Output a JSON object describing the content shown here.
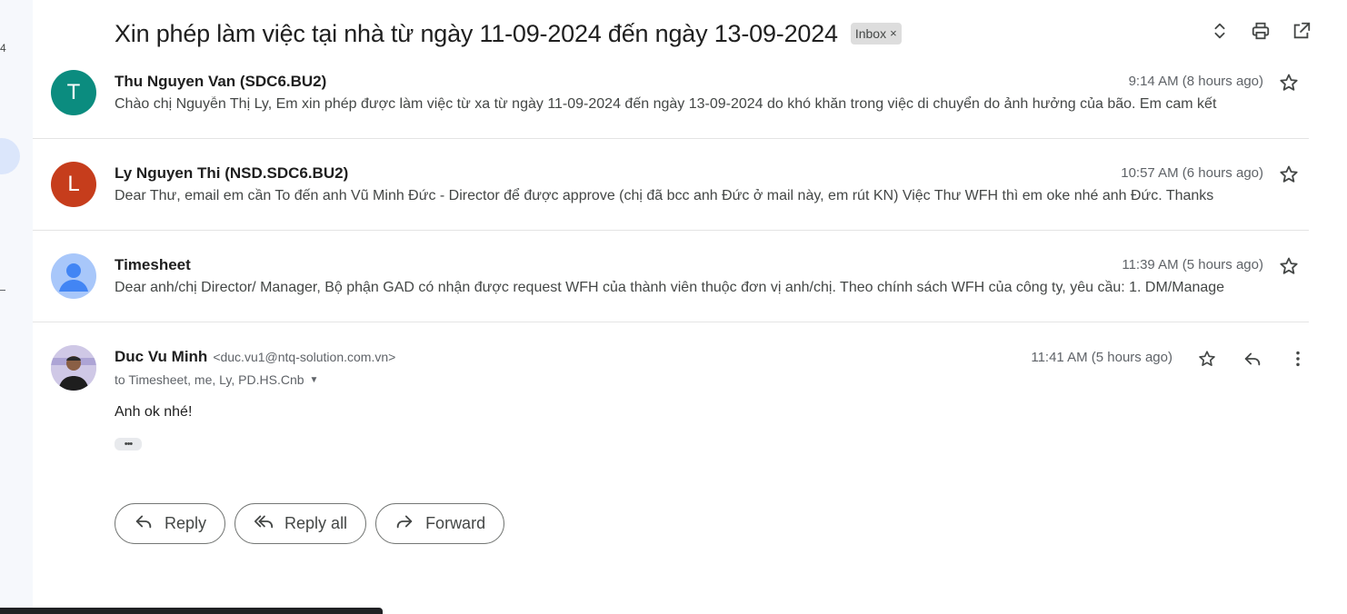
{
  "sidebar": {
    "count": "4"
  },
  "subject": {
    "title": "Xin phép làm việc tại nhà từ ngày 11-09-2024 đến ngày 13-09-2024",
    "label": "Inbox",
    "label_remove": "×"
  },
  "messages": [
    {
      "avatar_letter": "T",
      "avatar_color": "#0b8c7f",
      "sender": "Thu Nguyen Van (SDC6.BU2)",
      "time": "9:14 AM (8 hours ago)",
      "snippet": "Chào chị Nguyễn Thị Ly, Em xin phép được làm việc từ xa từ ngày 11-09-2024 đến ngày 13-09-2024 do khó khăn trong việc di chuyển do ảnh hưởng của bão. Em cam kết"
    },
    {
      "avatar_letter": "L",
      "avatar_color": "#c63d1c",
      "sender": "Ly Nguyen Thi (NSD.SDC6.BU2)",
      "time": "10:57 AM (6 hours ago)",
      "snippet": "Dear Thư, email em cần To đến anh Vũ Minh Đức - Director để được approve (chị đã bcc anh Đức ở mail này, em rút KN) Việc Thư WFH thì em oke nhé anh Đức. Thanks"
    },
    {
      "avatar_letter": "",
      "avatar_color": "#a8c7fa",
      "sender": "Timesheet",
      "time": "11:39 AM (5 hours ago)",
      "snippet": "Dear anh/chị Director/ Manager, Bộ phận GAD có nhận được request WFH của thành viên thuộc đơn vị anh/chị. Theo chính sách WFH của công ty, yêu cầu: 1. DM/Manage"
    }
  ],
  "open_message": {
    "sender_name": "Duc Vu Minh",
    "sender_email": "<duc.vu1@ntq-solution.com.vn>",
    "recipients": "to Timesheet, me, Ly, PD.HS.Cnb",
    "time": "11:41 AM (5 hours ago)",
    "body": "Anh ok nhé!",
    "trimmed": "•••"
  },
  "reply_actions": {
    "reply": "Reply",
    "reply_all": "Reply all",
    "forward": "Forward"
  },
  "colors": {
    "accent_bubble": "#dbe6fb",
    "divider": "#e4e4e4"
  }
}
